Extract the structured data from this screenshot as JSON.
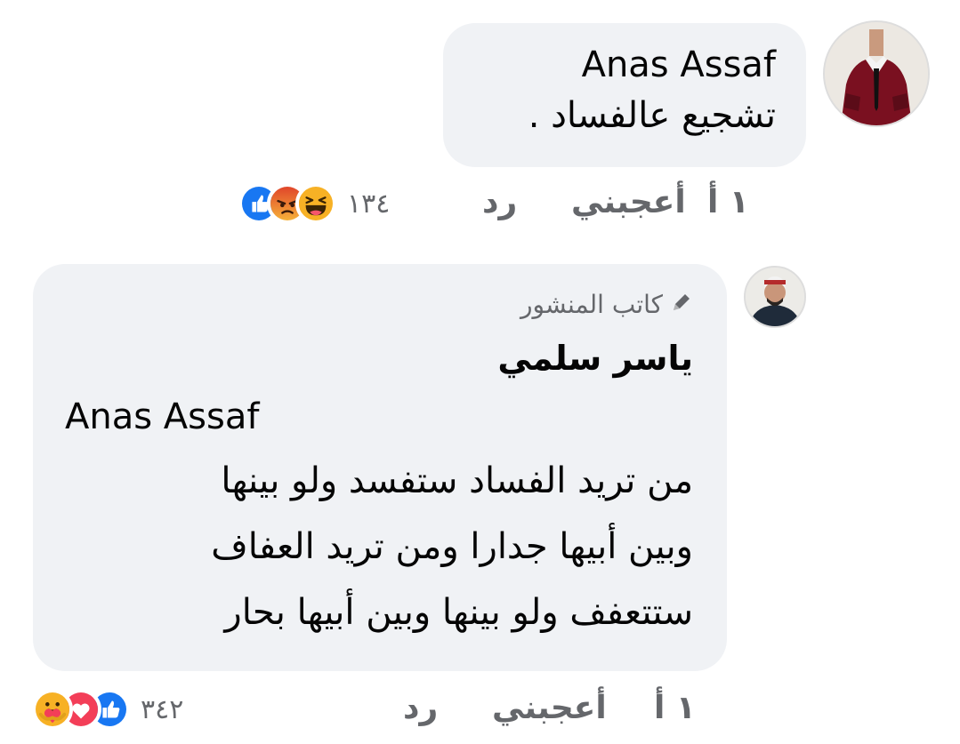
{
  "comments": [
    {
      "author": "Anas Assaf",
      "text": "تشجيع عالفساد .",
      "time": "١ أ",
      "like_label": "أعجبني",
      "reply_label": "رد",
      "reactions": [
        "haha-icon",
        "angry-icon",
        "like-icon"
      ],
      "reaction_count": "١٣٤"
    },
    {
      "badge": "كاتب المنشور",
      "author": "ياسر سلمي",
      "mention": "Anas Assaf",
      "lines": [
        "من تريد الفساد ستفسد ولو بينها",
        "وبين أبيها جدارا ومن تريد العفاف",
        "ستتعفف ولو بينها وبين أبيها بحار"
      ],
      "time": "١ أ",
      "like_label": "أعجبني",
      "reply_label": "رد",
      "reactions": [
        "care-icon",
        "love-icon",
        "like-icon"
      ],
      "reaction_count": "٣٤٢"
    }
  ],
  "colors": {
    "bubble": "#f0f2f5",
    "meta_gray": "#65676b",
    "like_blue": "#1877f2",
    "love_red": "#f33e58",
    "haha_yellow": "#f7b125",
    "angry_orange": "#e9710f"
  }
}
